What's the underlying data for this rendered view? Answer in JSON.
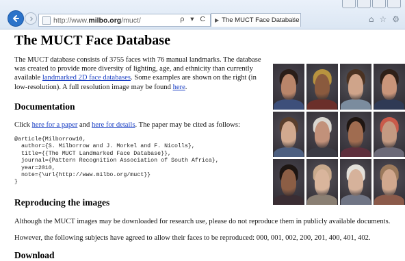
{
  "browser": {
    "url_prefix": "http://www.",
    "url_domain": "milbo.org",
    "url_path": "/muct/",
    "address_tools": "ρ ▾ C",
    "tab_title": "The MUCT Face Database",
    "tab_close": "×",
    "nav_icons": [
      "⌂",
      "☆",
      "⚙"
    ]
  },
  "page": {
    "title": "The MUCT Face Database",
    "intro": {
      "text_1": "The MUCT database consists of 3755 faces with 76 manual landmarks. The database was created to provide more diversity of lighting, age, and ethnicity than currently available ",
      "link_1": "landmarked 2D face databases",
      "text_2": ". Some examples are shown on the right (in low-resolution). A full resolution image may be found ",
      "link_2": "here",
      "text_3": "."
    },
    "documentation": {
      "heading": "Documentation",
      "text_1": "Click ",
      "link_paper": "here for a paper",
      "text_2": " and ",
      "link_details": "here for details",
      "text_3": ". The paper may be cited as follows:",
      "bibtex": "@article{Milborrow10,\n  author={S. Milborrow and J. Morkel and F. Nicolls},\n  title={{The MUCT Landmarked Face Database}},\n  journal={Pattern Recognition Association of South Africa},\n  year=2010,\n  note={\\url{http://www.milbo.org/muct}}\n}"
    },
    "reproducing": {
      "heading": "Reproducing the images",
      "para_1": "Although the MUCT images may be downloaded for research use, please do not reproduce them in publicly available documents.",
      "para_2": "However, the following subjects have agreed to allow their faces to be reproduced: 000, 001, 002, 200, 201, 400, 401, 402."
    },
    "download": {
      "heading": "Download"
    }
  },
  "faces": [
    {
      "name": "face-photo-1",
      "bg": "#4b4650",
      "skin": "#b9856a",
      "hair": "#2a1d18",
      "shirt": "#3d4f7a"
    },
    {
      "name": "face-photo-2",
      "bg": "#4d4c55",
      "skin": "#8a5a3e",
      "hair": "#b8933f",
      "shirt": "#6b2f2a"
    },
    {
      "name": "face-photo-3",
      "bg": "#57565c",
      "skin": "#cfa48a",
      "hair": "#4a3222",
      "shirt": "#7b8c9e"
    },
    {
      "name": "face-photo-4",
      "bg": "#4a4850",
      "skin": "#c9957a",
      "hair": "#2e2018",
      "shirt": "#2f3a55"
    },
    {
      "name": "face-photo-5",
      "bg": "#55505a",
      "skin": "#d1a98f",
      "hair": "#5a3f2d",
      "shirt": "#4d5f80"
    },
    {
      "name": "face-photo-6",
      "bg": "#4f4a52",
      "skin": "#c2917a",
      "hair": "#d9d6d0",
      "shirt": "#3b3b44"
    },
    {
      "name": "face-photo-7",
      "bg": "#504c55",
      "skin": "#a06c50",
      "hair": "#1f1612",
      "shirt": "#5e2f3c"
    },
    {
      "name": "face-photo-8",
      "bg": "#524e57",
      "skin": "#c49a82",
      "hair": "#c95a4a",
      "shirt": "#6c6a78"
    },
    {
      "name": "face-photo-9",
      "bg": "#4a4650",
      "skin": "#8c5e45",
      "hair": "#1d1512",
      "shirt": "#3a2d33"
    },
    {
      "name": "face-photo-10",
      "bg": "#58545c",
      "skin": "#d9b59c",
      "hair": "#c8a98c",
      "shirt": "#8a7f73"
    },
    {
      "name": "face-photo-11",
      "bg": "#56525a",
      "skin": "#d6b29b",
      "hair": "#e3e0da",
      "shirt": "#707585"
    },
    {
      "name": "face-photo-12",
      "bg": "#54505a",
      "skin": "#d1a88e",
      "hair": "#9c7a5c",
      "shirt": "#8b5a4a"
    }
  ]
}
